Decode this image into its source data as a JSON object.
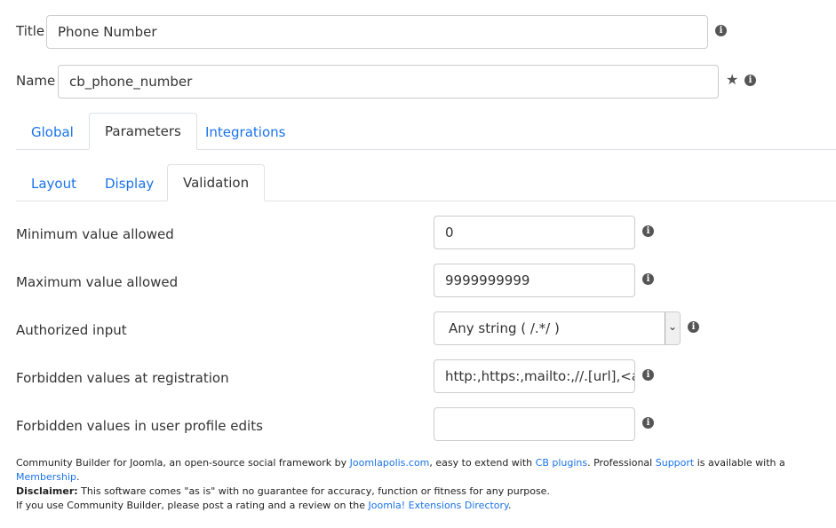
{
  "fields": {
    "title": {
      "label": "Title",
      "value": "Phone Number"
    },
    "name": {
      "label": "Name",
      "value": "cb_phone_number"
    }
  },
  "tabs_main": [
    "Global",
    "Parameters",
    "Integrations"
  ],
  "tabs_sub": [
    "Layout",
    "Display",
    "Validation"
  ],
  "validation": {
    "min": {
      "label": "Minimum value allowed",
      "value": "0"
    },
    "max": {
      "label": "Maximum value allowed",
      "value": "9999999999"
    },
    "authorized": {
      "label": "Authorized input",
      "value": "Any string ( /.*/ )"
    },
    "forbidden_reg": {
      "label": "Forbidden values at registration",
      "value": "http:,https:,mailto:,//.[url],<a,"
    },
    "forbidden_edit": {
      "label": "Forbidden values in user profile edits",
      "value": ""
    }
  },
  "icons": {
    "info": "i",
    "star": "★",
    "chevron": "⌄"
  },
  "footer": {
    "l1_a": "Community Builder for Joomla, an open-source social framework by ",
    "l1_link1": "Joomlapolis.com",
    "l1_b": ", easy to extend with ",
    "l1_link2": "CB plugins",
    "l1_c": ". Professional ",
    "l1_link3": "Support",
    "l1_d": " is available with a ",
    "l1_link4": "Membership",
    "l1_e": ".",
    "l2_bold": "Disclaimer:",
    "l2_text": " This software comes \"as is\" with no guarantee for accuracy, function or fitness for any purpose.",
    "l3_a": "If you use Community Builder, please post a rating and a review on the ",
    "l3_link": "Joomla! Extensions Directory",
    "l3_b": "."
  },
  "colors": {
    "link": "#1a73e8",
    "border": "#cccccc"
  }
}
